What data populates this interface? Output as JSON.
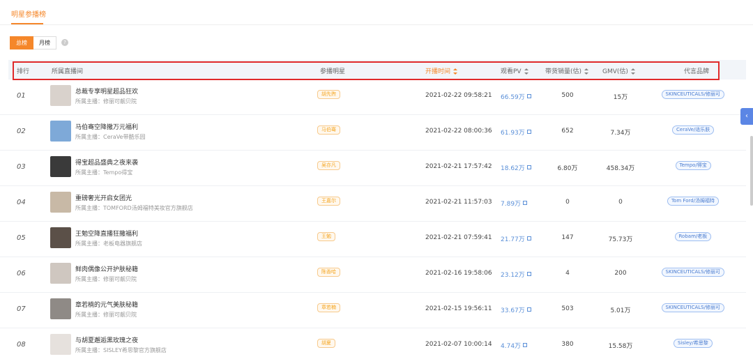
{
  "page_tab": "明星参播榜",
  "period_toggle": {
    "options": [
      "总榜",
      "月榜"
    ],
    "selected": "总榜"
  },
  "help_icon": "question-circle-icon",
  "columns": {
    "rank": "排行",
    "room": "所属直播间",
    "star": "参播明星",
    "start_time": "开播时间",
    "pv": "观看PV",
    "sales": "带货销量(估)",
    "gmv": "GMV(估)",
    "brand": "代言品牌"
  },
  "sorted_column": "start_time",
  "colors": {
    "accent": "#f5872a",
    "highlight_box": "#e02a2a",
    "link": "#5a8fd8",
    "brand_tag": "#4a7ccf"
  },
  "rows": [
    {
      "rank": "01",
      "title": "总裁专享明星超品狂欢",
      "anchor": "所属主播：修丽可靓贝院",
      "star": "胡先煦",
      "time": "2021-02-22 09:58:21",
      "pv": "66.59万",
      "sales": "500",
      "gmv": "15万",
      "brand": "SKINCEUTICALS/修丽可"
    },
    {
      "rank": "02",
      "title": "马伯骞空降撒万元福利",
      "anchor": "所属主播：CeraVe带酷乐园",
      "star": "马伯骞",
      "time": "2021-02-22 08:00:36",
      "pv": "61.93万",
      "sales": "652",
      "gmv": "7.34万",
      "brand": "CeraVe/适乐肤"
    },
    {
      "rank": "03",
      "title": "得宝超品盛典之夜来袭",
      "anchor": "所属主播：Tempo得宝",
      "star": "吴亦凡",
      "time": "2021-02-21 17:57:42",
      "pv": "18.62万",
      "sales": "6.80万",
      "gmv": "458.34万",
      "brand": "Tempo/得宝"
    },
    {
      "rank": "04",
      "title": "重磅奢光开启女团光",
      "anchor": "所属主播：TOMFORD汤姆福特美妆官方旗舰店",
      "star": "王嘉尔",
      "time": "2021-02-21 11:57:03",
      "pv": "7.89万",
      "sales": "0",
      "gmv": "0",
      "brand": "Tom Ford/汤姆福特"
    },
    {
      "rank": "05",
      "title": "王勉空降直播狂撒福利",
      "anchor": "所属主播：老板电器旗舰店",
      "star": "王勉",
      "time": "2021-02-21 07:59:41",
      "pv": "21.77万",
      "sales": "147",
      "gmv": "75.73万",
      "brand": "Robam/老板"
    },
    {
      "rank": "06",
      "title": "鲜肉偶像公开护肤秘籍",
      "anchor": "所属主播：修丽可靓贝院",
      "star": "陈香哈",
      "time": "2021-02-16 19:58:06",
      "pv": "23.12万",
      "sales": "4",
      "gmv": "200",
      "brand": "SKINCEUTICALS/修丽可"
    },
    {
      "rank": "07",
      "title": "章若楠的元气美肤秘籍",
      "anchor": "所属主播：修丽可靓贝院",
      "star": "章若楠",
      "time": "2021-02-15 19:56:11",
      "pv": "33.67万",
      "sales": "503",
      "gmv": "5.01万",
      "brand": "SKINCEUTICALS/修丽可"
    },
    {
      "rank": "08",
      "title": "与胡夏邂逅黑玫瑰之夜",
      "anchor": "所属主播：SISLEY希思黎官方旗舰店",
      "star": "胡夏",
      "time": "2021-02-07 10:00:14",
      "pv": "4.74万",
      "sales": "380",
      "gmv": "15.58万",
      "brand": "Sisley/希思黎"
    }
  ],
  "side_tab_icon": "chevron-left-icon"
}
